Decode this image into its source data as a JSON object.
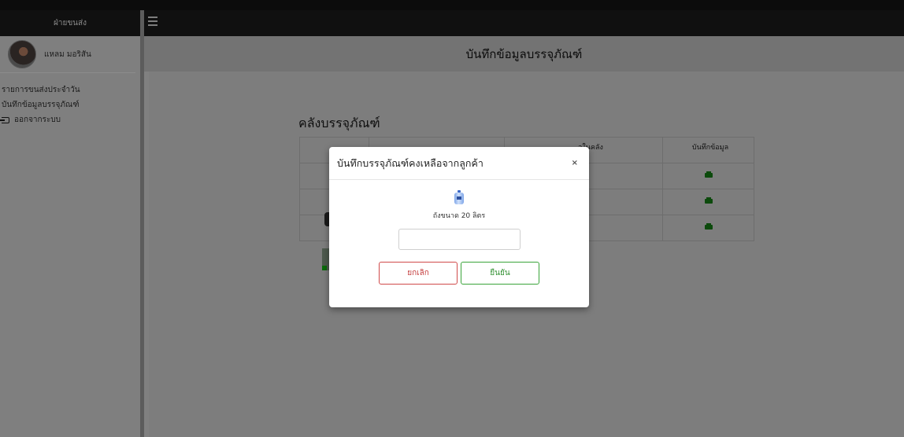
{
  "sidebar": {
    "brand": "ฝ่ายขนส่ง",
    "user_name": "แหลม มอริสัน",
    "menu": [
      {
        "label": "รายการขนส่งประจำวัน"
      },
      {
        "label": "บันทึกข้อมูลบรรจุภัณฑ์"
      },
      {
        "label": "ออกจากระบบ",
        "icon": "logout-icon"
      }
    ]
  },
  "header": {
    "page_title": "บันทึกข้อมูลบรรจุภัณฑ์"
  },
  "content": {
    "section_title": "คลังบรรจุภัณฑ์",
    "table": {
      "visible_headers": [
        "อในคลัง",
        "บันทึกข้อมูล"
      ],
      "rows": 3,
      "action_icon": "save-icon"
    }
  },
  "modal": {
    "title": "บันทึกบรรจุภัณฑ์คงเหลือจากลูกค้า",
    "close": "×",
    "item_icon": "water-bottle-icon",
    "item_name": "ถังขนาด 20 ลิตร",
    "quantity_value": "",
    "cancel_label": "ยกเลิก",
    "confirm_label": "ยืนยัน"
  },
  "colors": {
    "cancel": "#d04a4a",
    "confirm": "#3aa43a",
    "overlay": "#808080"
  }
}
